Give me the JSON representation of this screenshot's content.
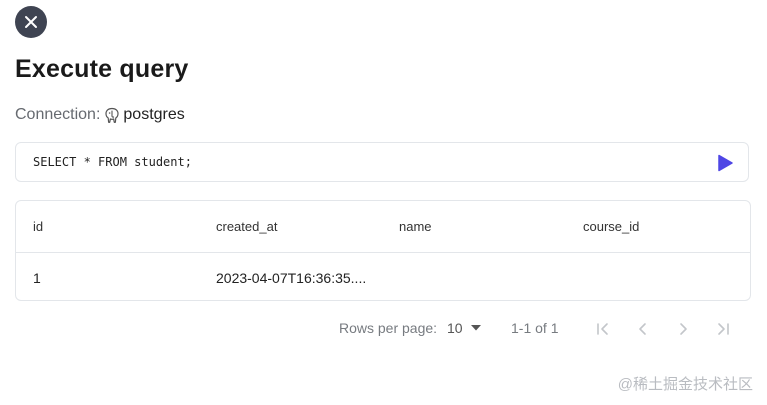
{
  "dialog": {
    "title": "Execute query",
    "close_icon": "close-icon"
  },
  "connection": {
    "label": "Connection:",
    "icon": "postgres-elephant-icon",
    "name": "postgres"
  },
  "query": {
    "text": "SELECT * FROM student;",
    "run_icon": "play-icon",
    "run_color": "#4f46e5"
  },
  "results": {
    "columns": [
      "id",
      "created_at",
      "name",
      "course_id"
    ],
    "rows": [
      [
        "1",
        "2023-04-07T16:36:35....",
        "",
        ""
      ]
    ]
  },
  "pagination": {
    "rows_per_page_label": "Rows per page:",
    "rows_per_page_value": "10",
    "range_label": "1-1 of 1",
    "icons": [
      "first-page-icon",
      "prev-page-icon",
      "next-page-icon",
      "last-page-icon"
    ]
  },
  "watermark": "@稀土掘金技术社区",
  "colors": {
    "close_bg": "#3f4452",
    "border": "#e3e6ea",
    "muted_text": "#777b80"
  }
}
